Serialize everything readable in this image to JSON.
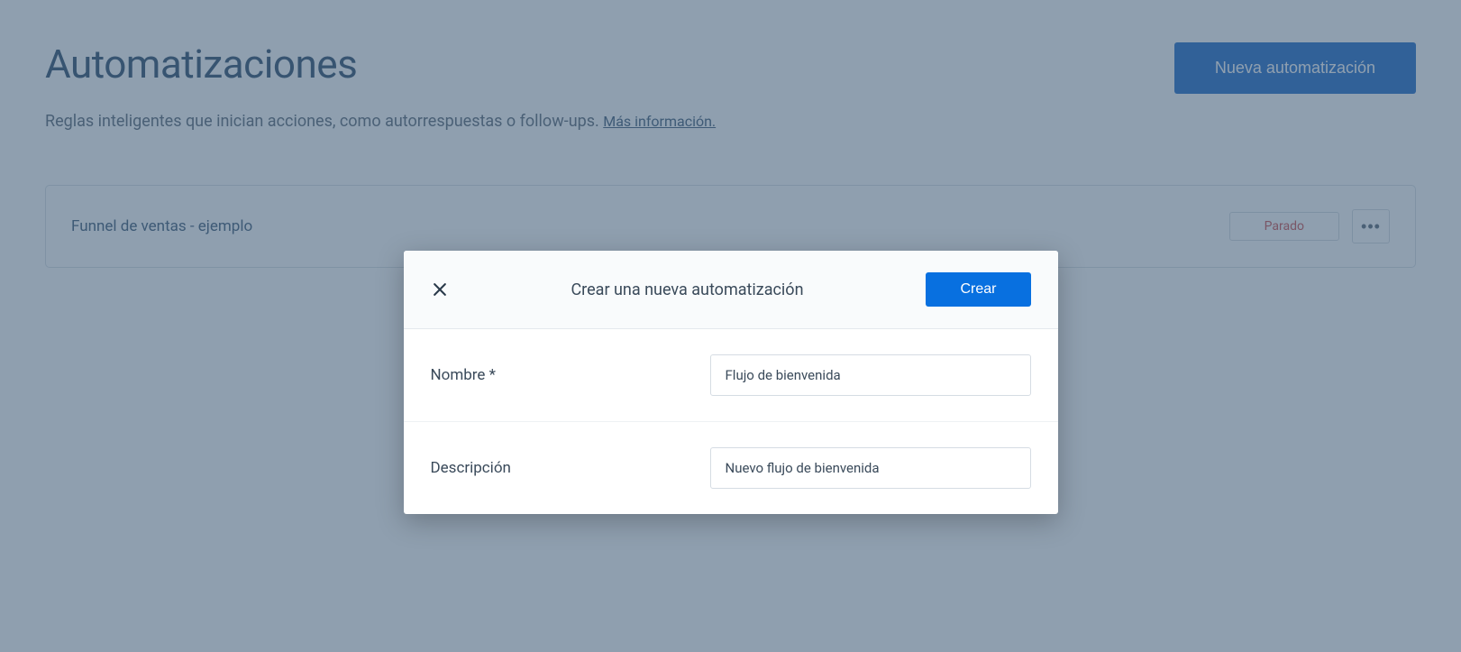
{
  "header": {
    "title": "Automatizaciones",
    "new_button": "Nueva automatización"
  },
  "subtitle": {
    "text": "Reglas inteligentes que inician acciones, como autorrespuestas o follow-ups. ",
    "link": "Más información."
  },
  "automation_list": [
    {
      "name": "Funnel de ventas - ejemplo",
      "status": "Parado"
    }
  ],
  "modal": {
    "title": "Crear una nueva automatización",
    "create_button": "Crear",
    "fields": {
      "name_label": "Nombre *",
      "name_value": "Flujo de bienvenida",
      "description_label": "Descripción",
      "description_value": "Nuevo flujo de bienvenida"
    }
  }
}
